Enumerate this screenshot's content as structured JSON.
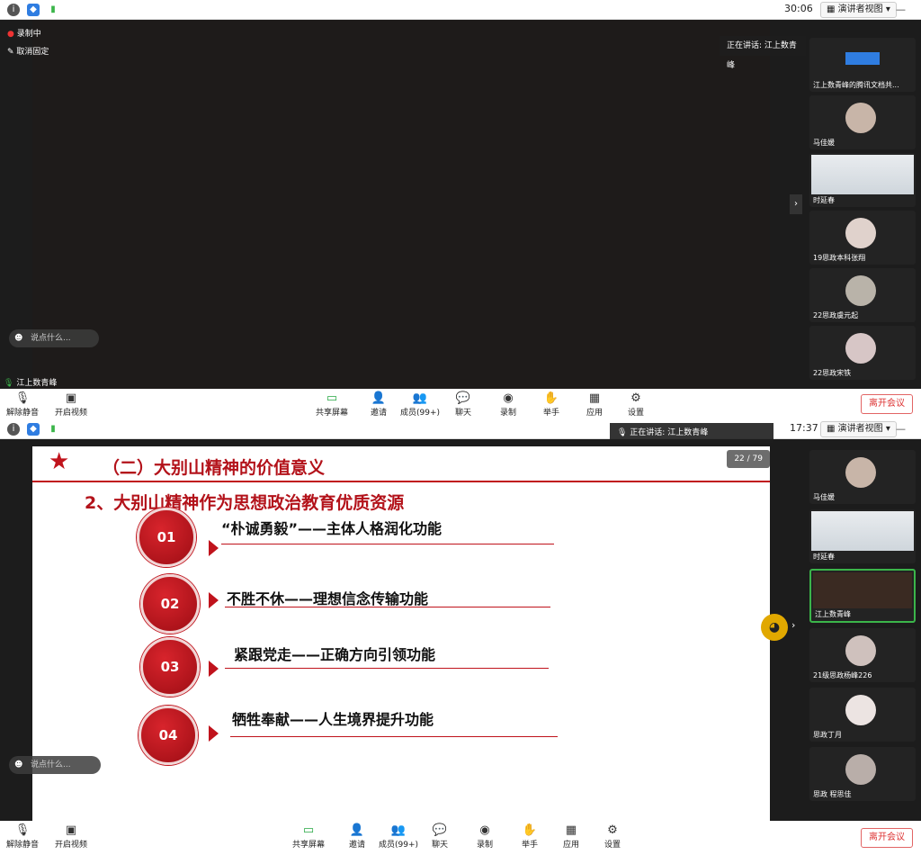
{
  "top_window": {
    "timer": "30:06",
    "view_mode": "演讲者视图",
    "recording": "录制中",
    "unpin": "取消固定",
    "speaking": "正在讲话: 江上数青峰",
    "comment_placeholder": "说点什么...",
    "main_speaker_name": "江上数青峰",
    "participants": [
      "江上数青峰的腾讯文档共...",
      "马佳媛",
      "时延春",
      "19思政本科张翔",
      "22思政虞元起",
      "22思政宋铁"
    ],
    "toolbar": {
      "unmute": "解除静音",
      "start_video": "开启视频",
      "share_screen": "共享屏幕",
      "invite": "邀请",
      "members": "成员(99+)",
      "chat": "聊天",
      "record": "录制",
      "raise_hand": "举手",
      "apps": "应用",
      "settings": "设置",
      "leave": "离开会议"
    }
  },
  "bottom_window": {
    "timer": "17:37",
    "view_mode": "演讲者视图",
    "speaking": "正在讲话: 江上数青峰",
    "comment_placeholder": "说点什么...",
    "page_indicator": "22 / 79",
    "participants": [
      "马佳媛",
      "时延春",
      "江上数青峰",
      "21级思政杨峰226",
      "思政丁月",
      "思政 程思佳"
    ],
    "toolbar": {
      "unmute": "解除静音",
      "start_video": "开启视频",
      "share_screen": "共享屏幕",
      "invite": "邀请",
      "members": "成员(99+)",
      "chat": "聊天",
      "record": "录制",
      "raise_hand": "举手",
      "apps": "应用",
      "settings": "设置",
      "leave": "离开会议"
    }
  },
  "slide": {
    "title": "（二）大别山精神的价值意义",
    "subtitle": "2、大别山精神作为思想政治教育优质资源",
    "items": [
      {
        "num": "01",
        "text": "“朴诚勇毅”——主体人格润化功能"
      },
      {
        "num": "02",
        "text": "不胜不休——理想信念传输功能"
      },
      {
        "num": "03",
        "text": "紧跟党走——正确方向引领功能"
      },
      {
        "num": "04",
        "text": "牺牲奉献——人生境界提升功能"
      }
    ]
  },
  "colors": {
    "accent_red": "#c0131c",
    "leave_red": "#d33333",
    "dark_bg": "#1c1c1c"
  }
}
